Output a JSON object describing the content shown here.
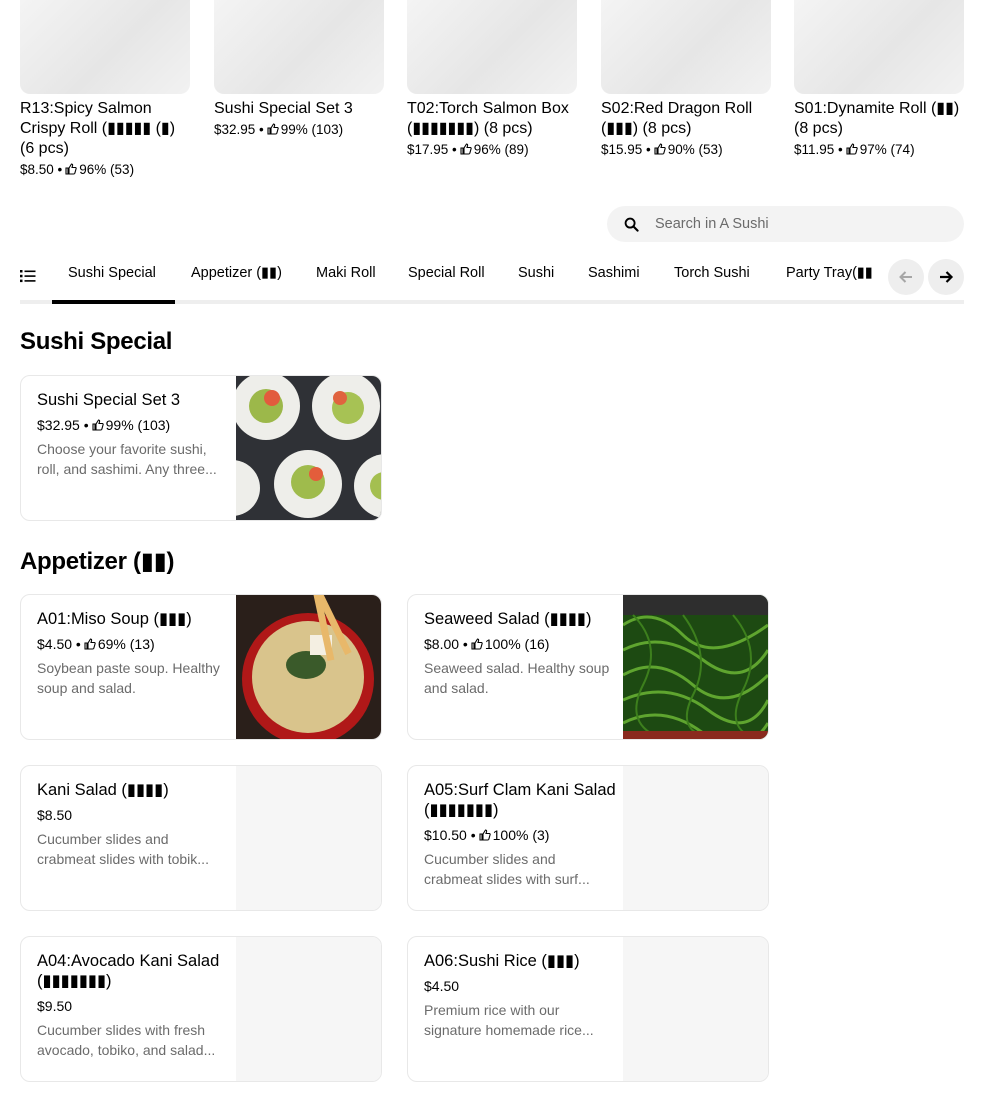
{
  "carousel": [
    {
      "title": "R13:Spicy Salmon Crispy Roll (▮▮▮▮▮ (▮) (6 pcs)",
      "price": "$8.50",
      "rating": "96% (53)"
    },
    {
      "title": "Sushi Special Set 3",
      "price": "$32.95",
      "rating": "99% (103)"
    },
    {
      "title": "T02:Torch Salmon Box (▮▮▮▮▮▮▮) (8 pcs)",
      "price": "$17.95",
      "rating": "96% (89)"
    },
    {
      "title": "S02:Red Dragon Roll (▮▮▮) (8 pcs)",
      "price": "$15.95",
      "rating": "90% (53)"
    },
    {
      "title": "S01:Dynamite Roll (▮▮) (8 pcs)",
      "price": "$11.95",
      "rating": "97% (74)"
    }
  ],
  "search": {
    "placeholder": "Search in A Sushi"
  },
  "tabs": [
    "Sushi Special",
    "Appetizer (▮▮)",
    "Maki Roll",
    "Special Roll",
    "Sushi",
    "Sashimi",
    "Torch Sushi",
    "Party Tray(▮▮"
  ],
  "sections": [
    {
      "title": "Sushi Special",
      "items": [
        {
          "name": "Sushi Special Set 3",
          "price": "$32.95",
          "rating": "99% (103)",
          "desc": "Choose your favorite sushi, roll, and sashimi. Any three..."
        }
      ]
    },
    {
      "title": "Appetizer (▮▮)",
      "items": [
        {
          "name": "A01:Miso Soup (▮▮▮)",
          "price": "$4.50",
          "rating": "69% (13)",
          "desc": "Soybean paste soup. Healthy soup and salad."
        },
        {
          "name": "Seaweed Salad (▮▮▮▮)",
          "price": "$8.00",
          "rating": "100% (16)",
          "desc": "Seaweed salad. Healthy soup and salad."
        },
        {
          "name": "Kani Salad (▮▮▮▮)",
          "price": "$8.50",
          "rating": "",
          "desc": "Cucumber slides and crabmeat slides with tobik..."
        },
        {
          "name": "A05:Surf Clam Kani Salad (▮▮▮▮▮▮▮)",
          "price": "$10.50",
          "rating": "100% (3)",
          "desc": "Cucumber slides and crabmeat slides with surf..."
        },
        {
          "name": "A04:Avocado Kani Salad (▮▮▮▮▮▮▮)",
          "price": "$9.50",
          "rating": "",
          "desc": "Cucumber slides with fresh avocado, tobiko, and salad..."
        },
        {
          "name": "A06:Sushi Rice (▮▮▮)",
          "price": "$4.50",
          "rating": "",
          "desc": "Premium rice with our signature homemade rice..."
        }
      ]
    }
  ],
  "colors": {
    "text": "#000000",
    "muted": "#6b6b6b",
    "border": "#e8e8e8",
    "chip": "#eeeeee"
  }
}
